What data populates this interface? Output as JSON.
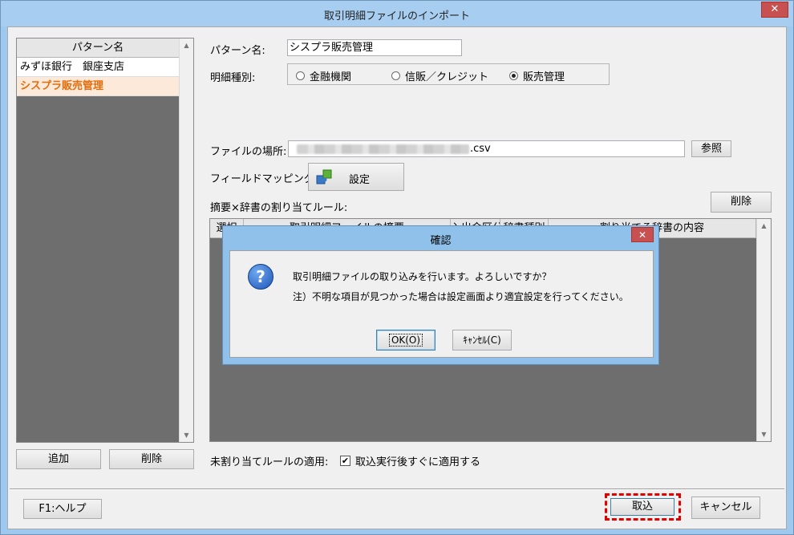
{
  "window": {
    "title": "取引明細ファイルのインポート",
    "close_symbol": "✕"
  },
  "pattern_list": {
    "header": "パターン名",
    "items": [
      "みずほ銀行　銀座支店",
      "シスプラ販売管理"
    ],
    "selected_index": 1
  },
  "left_buttons": {
    "add": "追加",
    "delete": "削除"
  },
  "form": {
    "pattern_name_label": "パターン名:",
    "pattern_name_value": "シスプラ販売管理",
    "detail_type_label": "明細種別:",
    "detail_types": [
      "金融機関",
      "信販／クレジット",
      "販売管理"
    ],
    "detail_type_selected": "販売管理",
    "file_location_label": "ファイルの場所:",
    "file_location_suffix": ".csv",
    "browse_button": "参照",
    "field_mapping_label": "フィールドマッピング:",
    "settings_button": "設定",
    "rule_label": "摘要×辞書の割り当てルール:",
    "rule_delete_button": "削除"
  },
  "grid": {
    "columns": [
      "選択",
      "取引明細ファイルの摘要",
      "入出金区分",
      "辞書種別",
      "割り当てる辞書の内容"
    ]
  },
  "unassigned": {
    "label": "未割り当てルールの適用:",
    "checkbox_label": "取込実行後すぐに適用する",
    "checked": true
  },
  "footer": {
    "help_button": "F1:ヘルプ",
    "import_button": "取込",
    "cancel_button": "キャンセル"
  },
  "dialog": {
    "title": "確認",
    "message": "取引明細ファイルの取り込みを行います。よろしいですか？",
    "note": "注）不明な項目が見つかった場合は設定画面より適宜設定を行ってください。",
    "ok_button": "OK(O)",
    "cancel_button": "ｷｬﾝｾﾙ(C)",
    "icon_glyph": "?"
  }
}
